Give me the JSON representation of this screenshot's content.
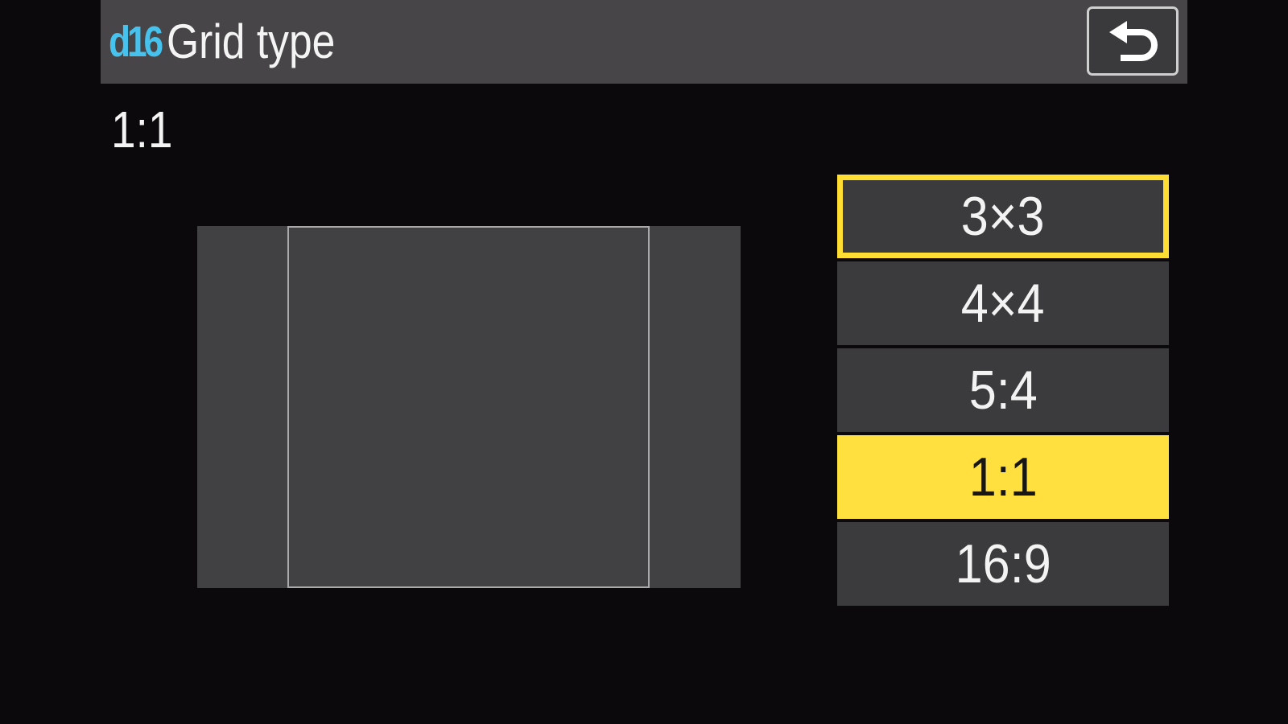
{
  "header": {
    "menu_code": "d16",
    "title": "Grid type",
    "back_icon": "return-arrow-icon"
  },
  "current_value": "1:1",
  "preview": {
    "aspect_ratio": "1:1"
  },
  "options": [
    {
      "label": "3×3",
      "state": "focused"
    },
    {
      "label": "4×4",
      "state": "normal"
    },
    {
      "label": "5:4",
      "state": "normal"
    },
    {
      "label": "1:1",
      "state": "selected"
    },
    {
      "label": "16:9",
      "state": "normal"
    }
  ],
  "colors": {
    "background": "#0b090c",
    "title_bar": "#474547",
    "menu_code": "#45c3ee",
    "option_bg": "#3b3a3c",
    "focus_border": "#ffdd33",
    "selected_bg": "#ffe03e"
  }
}
